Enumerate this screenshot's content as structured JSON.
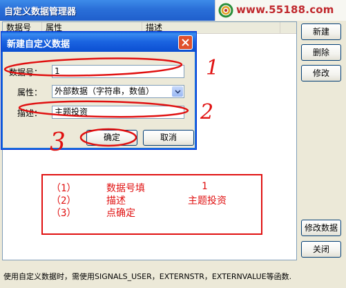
{
  "window": {
    "title": "自定义数据管理器",
    "watermark": "www.55188.com"
  },
  "list": {
    "columns": [
      "数据号",
      "属性",
      "描述"
    ]
  },
  "side_buttons": {
    "new": "新建",
    "delete": "删除",
    "modify": "修改",
    "modify_data": "修改数据",
    "close": "关闭"
  },
  "status": "使用自定义数据时，需使用SIGNALS_USER，EXTERNSTR，EXTERNVALUE等函数.",
  "dialog": {
    "title": "新建自定义数据",
    "number_label": "数据号：",
    "number_value": "1",
    "attr_label": "属性：",
    "attr_value": "外部数据（字符串，数值）",
    "desc_label": "描述：",
    "desc_value": "主题投资",
    "ok": "确定",
    "cancel": "取消"
  },
  "annotation": {
    "markers": [
      "1",
      "2",
      "3"
    ],
    "rows": [
      {
        "num": "（1）",
        "action": "数据号填",
        "value": "1"
      },
      {
        "num": "（2）",
        "action": "描述",
        "value": "主题投资"
      },
      {
        "num": "（3）",
        "action": "点确定",
        "value": ""
      }
    ],
    "color": "#e01010"
  }
}
